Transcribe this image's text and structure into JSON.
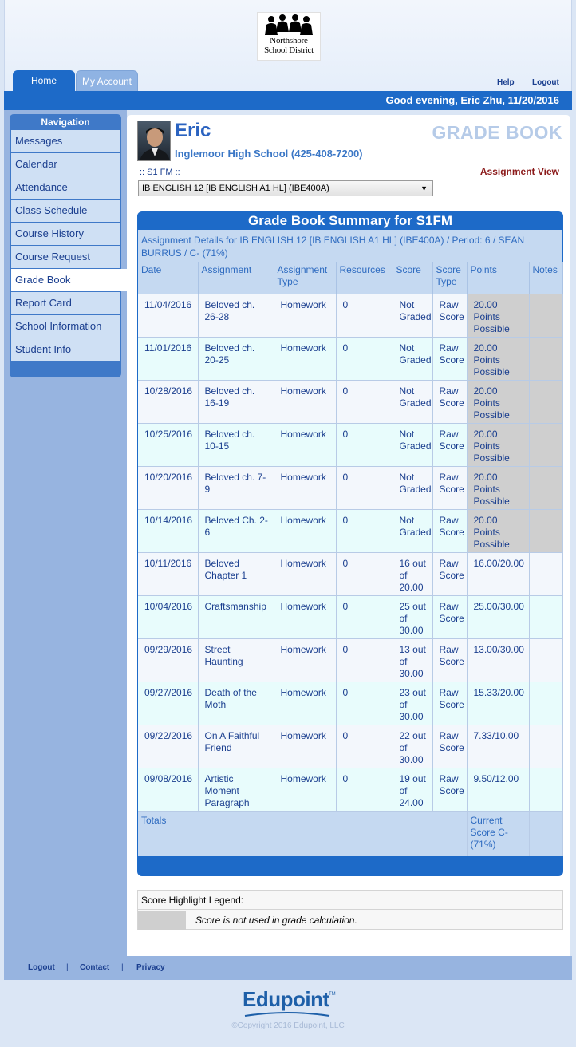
{
  "logo": {
    "line1": "Northshore",
    "line2": "School District"
  },
  "tabs": {
    "home": "Home",
    "my_account": "My Account"
  },
  "top_links": {
    "help": "Help",
    "logout": "Logout"
  },
  "greeting": "Good evening, Eric Zhu, 11/20/2016",
  "navigation": {
    "title": "Navigation",
    "items": [
      "Messages",
      "Calendar",
      "Attendance",
      "Class Schedule",
      "Course History",
      "Course Request",
      "Grade Book",
      "Report Card",
      "School Information",
      "Student Info"
    ],
    "active": "Grade Book"
  },
  "student": {
    "name": "Eric",
    "school": "Inglemoor High School (425-408-7200)"
  },
  "page_heading": "GRADE BOOK",
  "term_label": ":: S1 FM ::",
  "view_link": "Assignment View",
  "class_select": "IB ENGLISH 12 [IB ENGLISH A1 HL] (IBE400A)",
  "summary": {
    "title": "Grade Book Summary for S1FM",
    "details": "Assignment Details for IB ENGLISH 12 [IB ENGLISH A1 HL] (IBE400A) / Period: 6 / SEAN BURRUS / C- (71%)",
    "columns": [
      "Date",
      "Assignment",
      "Assignment Type",
      "Resources",
      "Score",
      "Score Type",
      "Points",
      "Notes"
    ],
    "rows": [
      {
        "date": "11/04/2016",
        "assignment": "Beloved ch. 26-28",
        "type": "Homework",
        "resources": "0",
        "score": "Not Graded",
        "score_type": "Raw Score",
        "points": "20.00 Points Possible",
        "notes": "",
        "highlight": true
      },
      {
        "date": "11/01/2016",
        "assignment": "Beloved ch. 20-25",
        "type": "Homework",
        "resources": "0",
        "score": "Not Graded",
        "score_type": "Raw Score",
        "points": "20.00 Points Possible",
        "notes": "",
        "highlight": true
      },
      {
        "date": "10/28/2016",
        "assignment": "Beloved ch. 16-19",
        "type": "Homework",
        "resources": "0",
        "score": "Not Graded",
        "score_type": "Raw Score",
        "points": "20.00 Points Possible",
        "notes": "",
        "highlight": true
      },
      {
        "date": "10/25/2016",
        "assignment": "Beloved ch. 10-15",
        "type": "Homework",
        "resources": "0",
        "score": "Not Graded",
        "score_type": "Raw Score",
        "points": "20.00 Points Possible",
        "notes": "",
        "highlight": true
      },
      {
        "date": "10/20/2016",
        "assignment": "Beloved ch. 7-9",
        "type": "Homework",
        "resources": "0",
        "score": "Not Graded",
        "score_type": "Raw Score",
        "points": "20.00 Points Possible",
        "notes": "",
        "highlight": true
      },
      {
        "date": "10/14/2016",
        "assignment": "Beloved Ch. 2-6",
        "type": "Homework",
        "resources": "0",
        "score": "Not Graded",
        "score_type": "Raw Score",
        "points": "20.00 Points Possible",
        "notes": "",
        "highlight": true
      },
      {
        "date": "10/11/2016",
        "assignment": "Beloved Chapter 1",
        "type": "Homework",
        "resources": "0",
        "score": "16 out of 20.00",
        "score_type": "Raw Score",
        "points": "16.00/20.00",
        "notes": "",
        "highlight": false
      },
      {
        "date": "10/04/2016",
        "assignment": "Craftsmanship",
        "type": "Homework",
        "resources": "0",
        "score": "25 out of 30.00",
        "score_type": "Raw Score",
        "points": "25.00/30.00",
        "notes": "",
        "highlight": false
      },
      {
        "date": "09/29/2016",
        "assignment": "Street Haunting",
        "type": "Homework",
        "resources": "0",
        "score": "13 out of 30.00",
        "score_type": "Raw Score",
        "points": "13.00/30.00",
        "notes": "",
        "highlight": false
      },
      {
        "date": "09/27/2016",
        "assignment": "Death of the Moth",
        "type": "Homework",
        "resources": "0",
        "score": "23 out of 30.00",
        "score_type": "Raw Score",
        "points": "15.33/20.00",
        "notes": "",
        "highlight": false
      },
      {
        "date": "09/22/2016",
        "assignment": "On A Faithful Friend",
        "type": "Homework",
        "resources": "0",
        "score": "22 out of 30.00",
        "score_type": "Raw Score",
        "points": "7.33/10.00",
        "notes": "",
        "highlight": false
      },
      {
        "date": "09/08/2016",
        "assignment": "Artistic Moment Paragraph",
        "type": "Homework",
        "resources": "0",
        "score": "19 out of 24.00",
        "score_type": "Raw Score",
        "points": "9.50/12.00",
        "notes": "",
        "highlight": false
      }
    ],
    "totals_label": "Totals",
    "current_score": "Current Score C- (71%)"
  },
  "legend": {
    "title": "Score Highlight Legend:",
    "text": "Score is not used in grade calculation."
  },
  "footer": {
    "logout": "Logout",
    "contact": "Contact",
    "privacy": "Privacy",
    "separator": "|"
  },
  "brand": {
    "name": "Edupoint",
    "tm": "TM",
    "copyright": "©Copyright 2016 Edupoint, LLC"
  },
  "colors": {
    "primary_blue": "#1d6ac8",
    "nav_bg": "#97b4e0",
    "highlight_gray": "#cfcfcf",
    "link_red": "#8b1a1a"
  }
}
